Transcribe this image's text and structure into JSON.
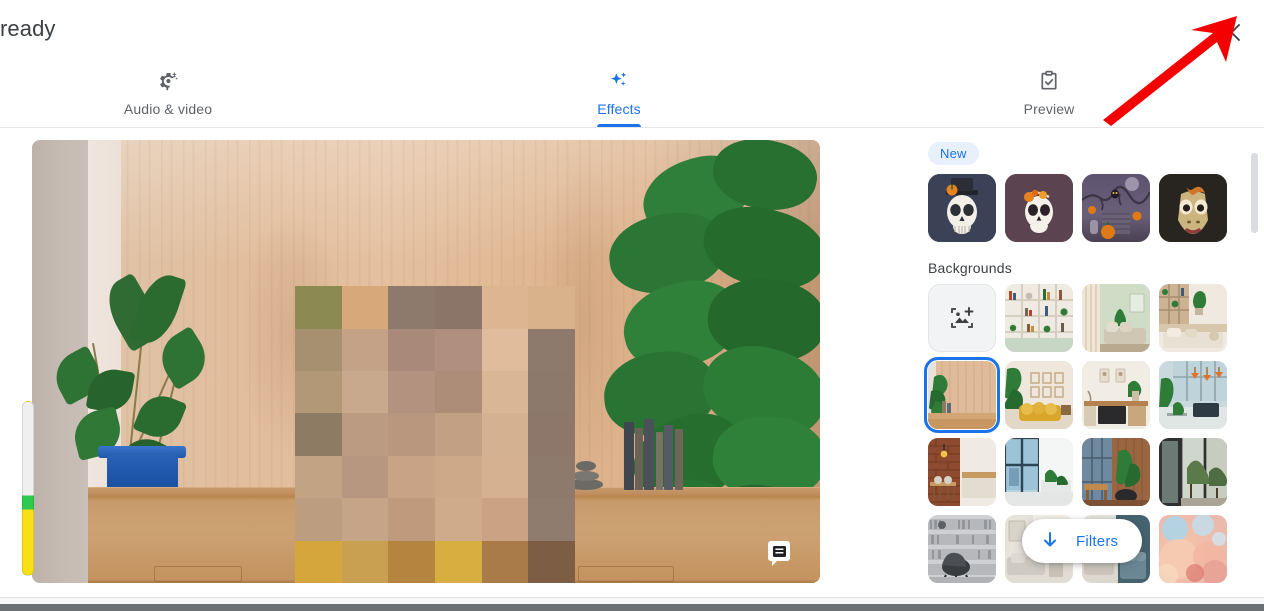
{
  "window": {
    "title": "ready",
    "close_icon": "close-icon"
  },
  "tabs": [
    {
      "id": "audio",
      "label": "Audio & video",
      "icon": "settings-sparkle-icon",
      "active": false
    },
    {
      "id": "effects",
      "label": "Effects",
      "icon": "sparkles-icon",
      "active": true
    },
    {
      "id": "preview",
      "label": "Preview",
      "icon": "clipboard-check-icon",
      "active": false
    }
  ],
  "video": {
    "badge_icon": "caption-badge-icon",
    "level_indicator": "audio-level-indicator",
    "description": "self-view video preview with virtual background"
  },
  "effects_panel": {
    "new_badge": "New",
    "section_title": "Backgrounds",
    "filters_button": {
      "label": "Filters",
      "icon": "arrow-down-icon"
    },
    "new_effects": [
      {
        "name": "skull-top-hat-effect",
        "bg": "#3b4258"
      },
      {
        "name": "sugar-skull-flower-effect",
        "bg": "#5b4450"
      },
      {
        "name": "halloween-graveyard-effect",
        "bg": "#4a4258"
      },
      {
        "name": "dino-face-effect",
        "bg": "#282420"
      }
    ],
    "backgrounds": [
      {
        "name": "upload-background-tile",
        "type": "add",
        "selected": false
      },
      {
        "name": "shelves-background",
        "type": "image",
        "selected": false
      },
      {
        "name": "green-bedroom-background",
        "type": "image",
        "selected": false
      },
      {
        "name": "plant-shelf-background",
        "type": "image",
        "selected": false
      },
      {
        "name": "wood-wall-plant-background",
        "type": "image",
        "selected": true
      },
      {
        "name": "yellow-sofa-background",
        "type": "image",
        "selected": false
      },
      {
        "name": "home-office-background",
        "type": "image",
        "selected": false
      },
      {
        "name": "loft-lamps-background",
        "type": "image",
        "selected": false
      },
      {
        "name": "brick-kitchen-background",
        "type": "image",
        "selected": false
      },
      {
        "name": "glass-window-background",
        "type": "image",
        "selected": false
      },
      {
        "name": "plant-lounge-background",
        "type": "image",
        "selected": false
      },
      {
        "name": "garden-window-background",
        "type": "image",
        "selected": false
      },
      {
        "name": "library-chair-background",
        "type": "image",
        "selected": false
      },
      {
        "name": "grey-sofa-background",
        "type": "image",
        "selected": false
      },
      {
        "name": "blue-sofa-background",
        "type": "image",
        "selected": false
      },
      {
        "name": "pastel-blur-background",
        "type": "image",
        "selected": false
      }
    ],
    "scrollbar": "panel-scrollbar"
  },
  "annotation": {
    "arrow": "red-pointer-arrow",
    "color": "#f50000"
  },
  "colors": {
    "accent": "#1a73e8",
    "badge_bg": "#e8f0fe",
    "text": "#3c4043",
    "muted_text": "#5f6368"
  }
}
